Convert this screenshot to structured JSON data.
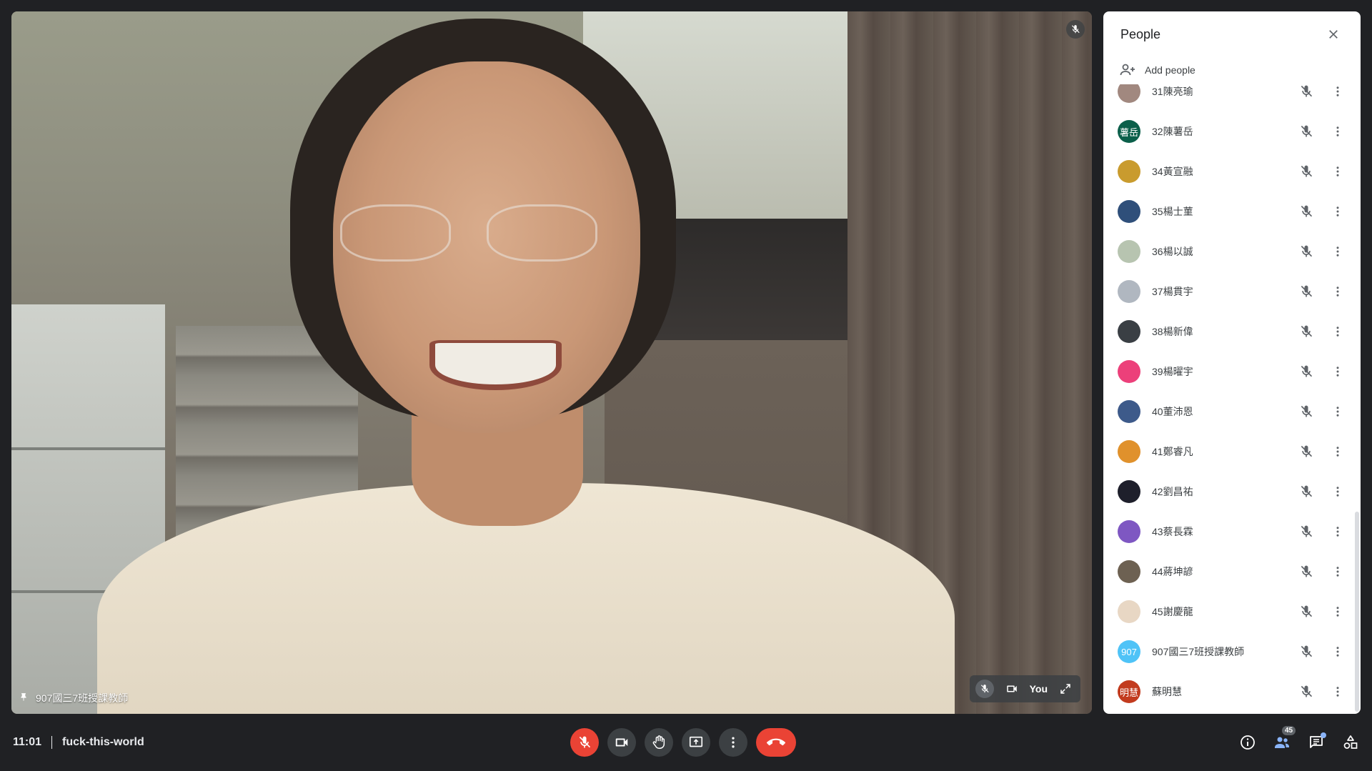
{
  "main_tile": {
    "participant_name": "907國三7班授課教師"
  },
  "self_view": {
    "label": "You"
  },
  "people_panel": {
    "title": "People",
    "add_people_label": "Add people",
    "participants": [
      {
        "name": "31陳亮瑜",
        "avatar_text": "",
        "avatar_color": "#a1887f"
      },
      {
        "name": "32陳薯岳",
        "avatar_text": "薯岳",
        "avatar_color": "#0b5f4a"
      },
      {
        "name": "34黃宣融",
        "avatar_text": "",
        "avatar_color": "#c99b2e"
      },
      {
        "name": "35楊士菫",
        "avatar_text": "",
        "avatar_color": "#2f4f7a"
      },
      {
        "name": "36楊以誠",
        "avatar_text": "",
        "avatar_color": "#b7c4b0"
      },
      {
        "name": "37楊貫宇",
        "avatar_text": "",
        "avatar_color": "#b0b7c0"
      },
      {
        "name": "38楊新偉",
        "avatar_text": "",
        "avatar_color": "#3a3f44"
      },
      {
        "name": "39楊曜宇",
        "avatar_text": "",
        "avatar_color": "#ec407a"
      },
      {
        "name": "40董沛恩",
        "avatar_text": "",
        "avatar_color": "#3d5a8a"
      },
      {
        "name": "41鄭睿凡",
        "avatar_text": "",
        "avatar_color": "#e0912c"
      },
      {
        "name": "42劉昌祐",
        "avatar_text": "",
        "avatar_color": "#1e1f2b"
      },
      {
        "name": "43蔡長霖",
        "avatar_text": "",
        "avatar_color": "#7e57c2"
      },
      {
        "name": "44蔣坤諺",
        "avatar_text": "",
        "avatar_color": "#6d6152"
      },
      {
        "name": "45謝慶龍",
        "avatar_text": "",
        "avatar_color": "#e8d7c4"
      },
      {
        "name": "907國三7班授課教師",
        "avatar_text": "907",
        "avatar_color": "#4fc3f7"
      },
      {
        "name": "蘇明慧",
        "avatar_text": "明慧",
        "avatar_color": "#c23b1e"
      }
    ]
  },
  "bottom_bar": {
    "time": "11:01",
    "meeting_code": "fuck-this-world",
    "people_count": "45"
  },
  "colors": {
    "background": "#202124",
    "hangup_red": "#ea4335",
    "panel_bg": "#ffffff"
  }
}
